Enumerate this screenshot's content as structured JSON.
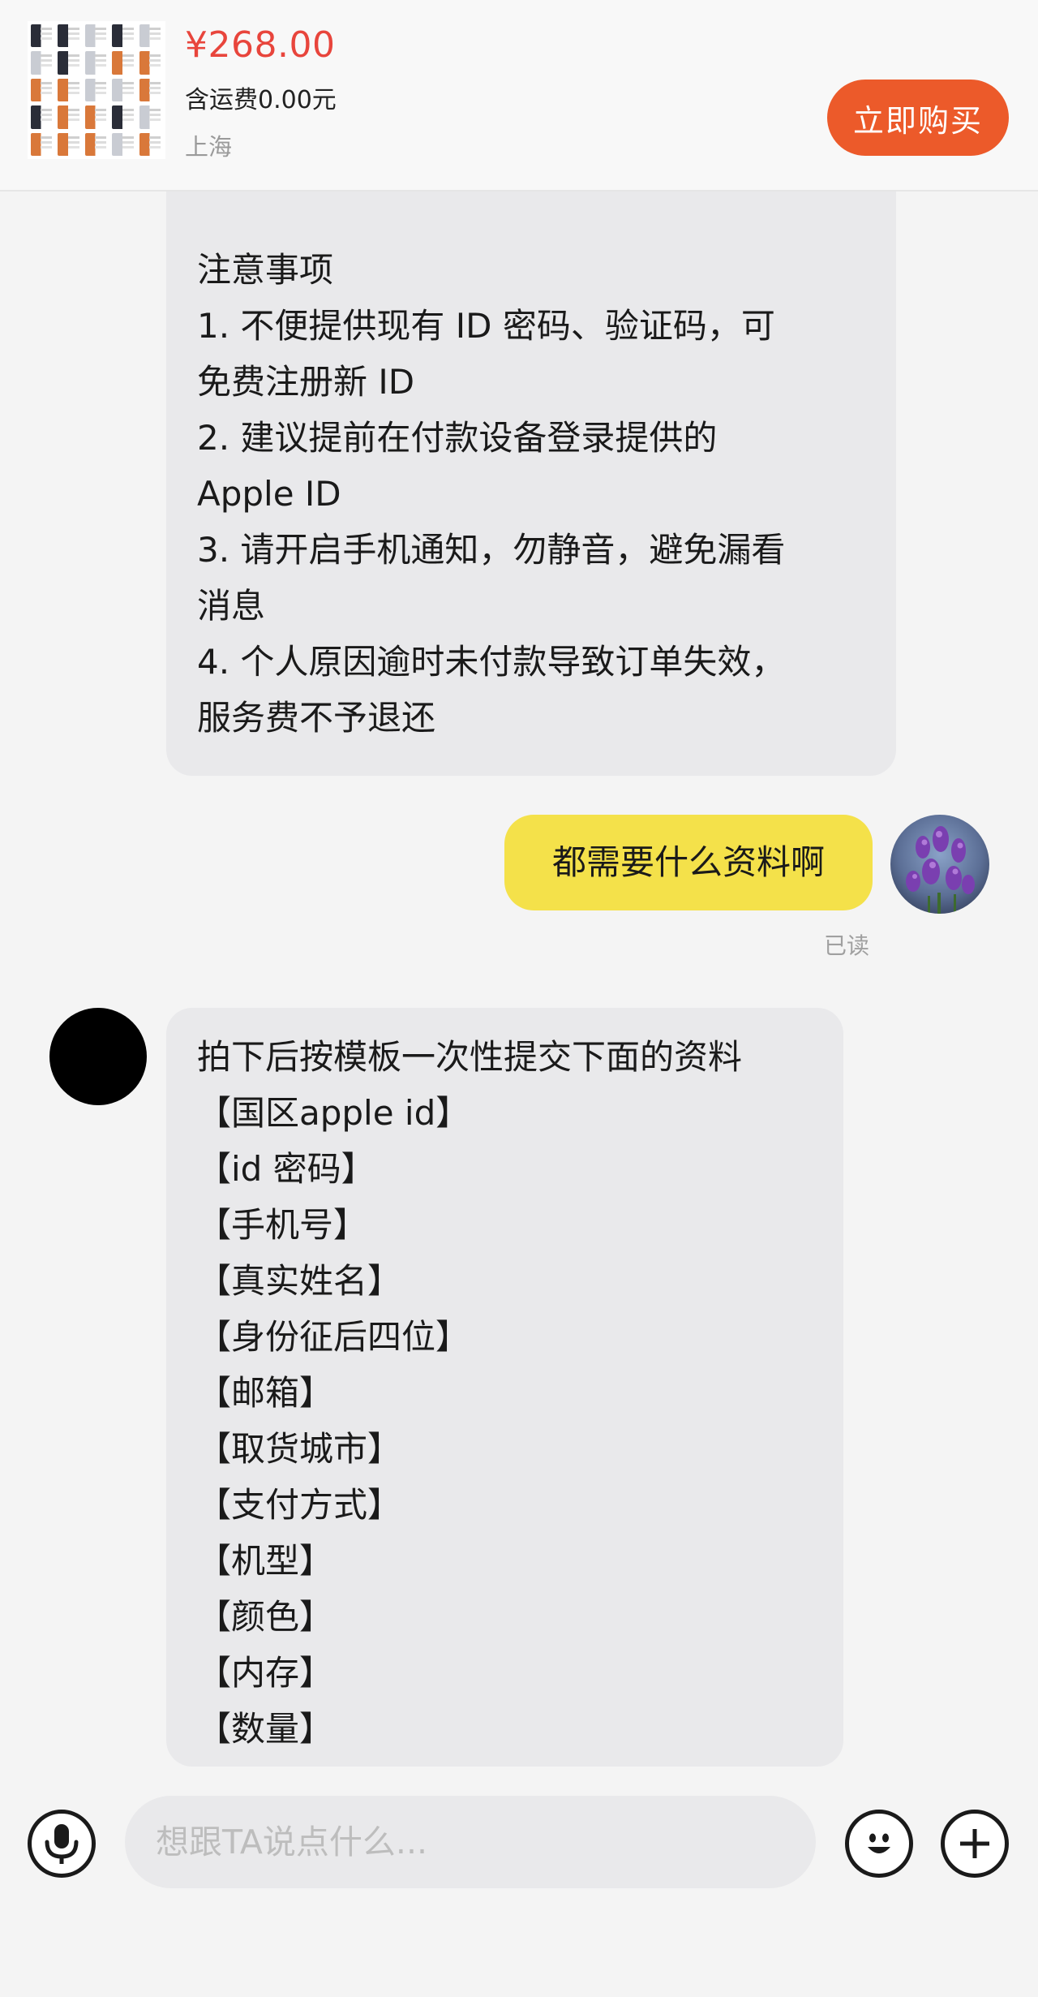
{
  "product": {
    "price": "¥268.00",
    "shipping": "含运费0.00元",
    "location": "上海",
    "buy_label": "立即购买",
    "price_color": "#e8453c",
    "buy_color": "#ec5a2a"
  },
  "messages": {
    "partial_seller": {
      "lines": [
        "注意事项",
        "1. 不便提供现有 ID 密码、验证码，可",
        "免费注册新 ID",
        "2. 建议提前在付款设备登录提供的",
        "Apple ID",
        "3. 请开启手机通知，勿静音，避免漏看",
        "消息",
        "4. 个人原因逾时未付款导致订单失效，",
        "服务费不予退还"
      ]
    },
    "mine": {
      "text": "都需要什么资料啊",
      "read_status": "已读",
      "bubble_color": "#f4e14a"
    },
    "seller": {
      "lines": [
        "拍下后按模板一次性提交下面的资料",
        "【国区apple id】",
        "【id 密码】",
        "【手机号】",
        "【真实姓名】",
        "【身份征后四位】",
        "【邮箱】",
        "【取货城市】",
        "【支付方式】",
        "【机型】",
        "【颜色】",
        "【内存】",
        "【数量】"
      ]
    }
  },
  "input_bar": {
    "placeholder": "想跟TA说点什么...",
    "icons": [
      "microphone-icon",
      "emoji-icon",
      "plus-icon"
    ]
  }
}
